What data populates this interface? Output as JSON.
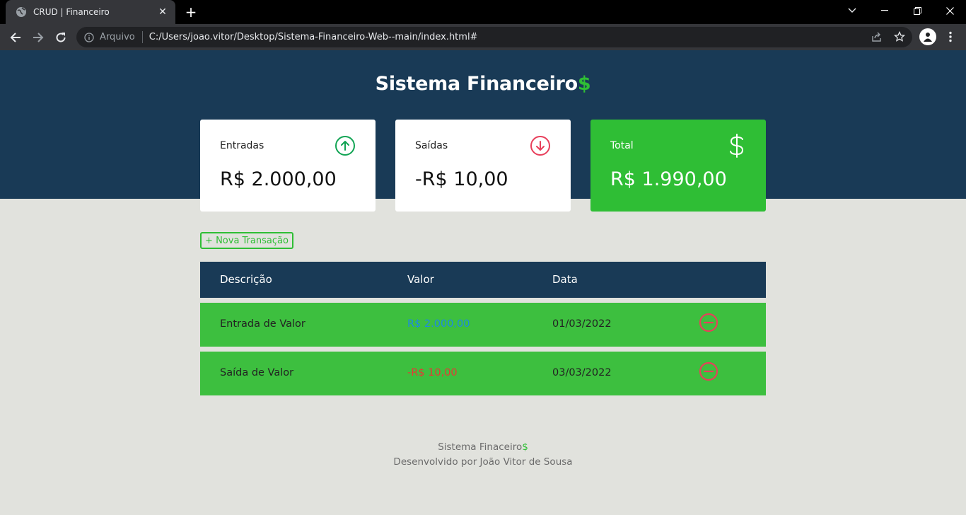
{
  "browser": {
    "tab_title": "CRUD | Financeiro",
    "tab_close": "✕",
    "new_tab": "+",
    "scheme_label": "Arquivo",
    "url": "C:/Users/joao.vitor/Desktop/Sistema-Financeiro-Web--main/index.html#"
  },
  "header": {
    "title": "Sistema Financeiro",
    "title_suffix": "$"
  },
  "cards": {
    "income": {
      "label": "Entradas",
      "value": "R$ 2.000,00",
      "icon": "arrow-up-circle-icon",
      "color": "#12a454"
    },
    "expense": {
      "label": "Saídas",
      "value": "-R$ 10,00",
      "icon": "arrow-down-circle-icon",
      "color": "#e83f5b"
    },
    "total": {
      "label": "Total",
      "value": "R$ 1.990,00",
      "icon": "dollar-sign-icon",
      "color": "#2fbe35"
    }
  },
  "new_transaction_label": "+ Nova Transação",
  "table": {
    "headers": [
      "Descrição",
      "Valor",
      "Data"
    ],
    "rows": [
      {
        "description": "Entrada de Valor",
        "amount": "R$ 2.000,00",
        "date": "01/03/2022"
      },
      {
        "description": "Saída de Valor",
        "amount": "-R$ 10,00",
        "date": "03/03/2022"
      }
    ]
  },
  "footer": {
    "line1": "Sistema Finaceiro",
    "line1_suffix": "$",
    "line2": "Desenvolvido por João Vitor de Sousa"
  },
  "colors": {
    "hero": "#193a56",
    "accent_green": "#2fbe35",
    "row_green": "#3dbf3f",
    "income_blue": "#1e88e5",
    "expense_red": "#e53935",
    "delete_red": "#e83f5b"
  }
}
